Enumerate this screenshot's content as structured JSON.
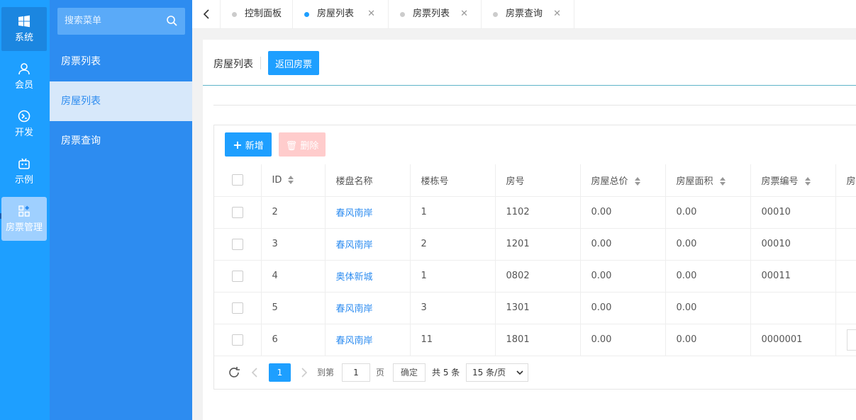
{
  "rail": {
    "items": [
      {
        "label": "系统",
        "icon": "windows-icon"
      },
      {
        "label": "会员",
        "icon": "user-icon"
      },
      {
        "label": "开发",
        "icon": "dev-icon"
      },
      {
        "label": "示例",
        "icon": "robot-icon"
      },
      {
        "label": "房票管理",
        "icon": "apps-icon"
      }
    ]
  },
  "sidebar": {
    "search_placeholder": "搜索菜单",
    "items": [
      {
        "label": "房票列表"
      },
      {
        "label": "房屋列表"
      },
      {
        "label": "房票查询"
      }
    ]
  },
  "tabs": [
    {
      "label": "控制面板",
      "closable": false
    },
    {
      "label": "房屋列表",
      "closable": true,
      "active": true
    },
    {
      "label": "房票列表",
      "closable": true
    },
    {
      "label": "房票查询",
      "closable": true
    }
  ],
  "page": {
    "breadcrumb": "房屋列表",
    "back_label": "返回房票"
  },
  "toolbar": {
    "add_label": "新增",
    "delete_label": "删除"
  },
  "table": {
    "columns": [
      "ID",
      "楼盘名称",
      "楼栋号",
      "房号",
      "房屋总价",
      "房屋面积",
      "房票编号",
      "房"
    ],
    "rows": [
      {
        "id": "2",
        "name": "春风南岸",
        "building": "1",
        "room": "1102",
        "price": "0.00",
        "area": "0.00",
        "ticket": "00010"
      },
      {
        "id": "3",
        "name": "春风南岸",
        "building": "2",
        "room": "1201",
        "price": "0.00",
        "area": "0.00",
        "ticket": "00010"
      },
      {
        "id": "4",
        "name": "奥体新城",
        "building": "1",
        "room": "0802",
        "price": "0.00",
        "area": "0.00",
        "ticket": "00011"
      },
      {
        "id": "5",
        "name": "春风南岸",
        "building": "3",
        "room": "1301",
        "price": "0.00",
        "area": "0.00",
        "ticket": ""
      },
      {
        "id": "6",
        "name": "春风南岸",
        "building": "11",
        "room": "1801",
        "price": "0.00",
        "area": "0.00",
        "ticket": "0000001"
      }
    ]
  },
  "pager": {
    "current": "1",
    "goto_label": "到第",
    "goto_value": "1",
    "page_unit": "页",
    "confirm_label": "确定",
    "total_label": "共 5 条",
    "page_size_label": "15 条/页"
  },
  "colors": {
    "primary": "#1e9fff",
    "sidebar": "#2d8cf0",
    "danger_disabled": "#ffcccc"
  }
}
